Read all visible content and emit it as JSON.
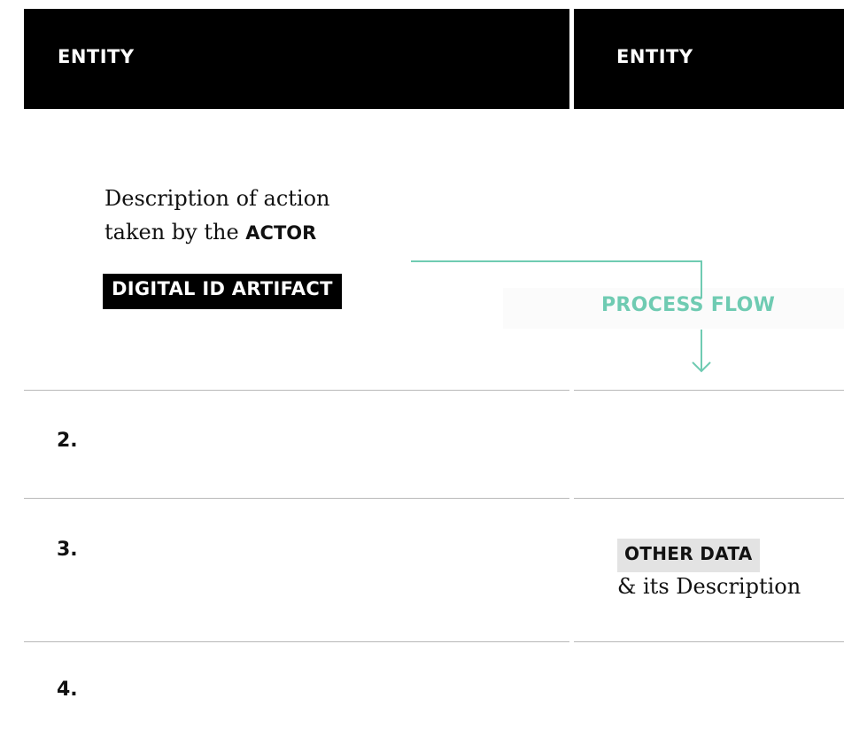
{
  "header": {
    "left_entity": "ENTITY",
    "right_entity": "ENTITY"
  },
  "step1": {
    "description_line1": "Description of action",
    "description_line2_prefix": "taken by the ",
    "actor": "ACTOR",
    "artifact": "DIGITAL ID ARTIFACT"
  },
  "flow": {
    "label": "PROCESS FLOW",
    "color": "#6fcbb2"
  },
  "steps": {
    "step2": "2.",
    "step3": "3.",
    "step4": "4."
  },
  "other": {
    "tag": "OTHER DATA",
    "description": "& its Description"
  }
}
